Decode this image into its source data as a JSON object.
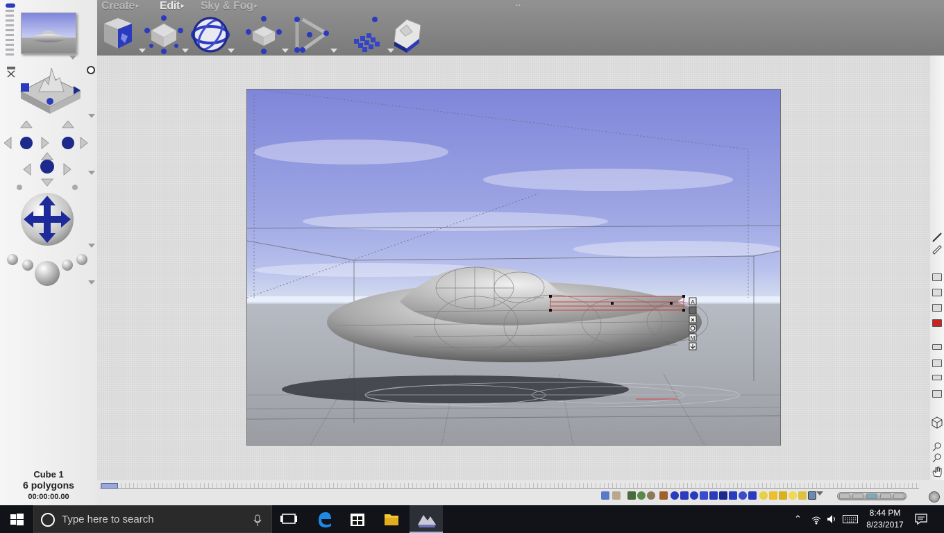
{
  "menu": {
    "create": "Create",
    "edit": "Edit",
    "sky_fog": "Sky & Fog",
    "arrow": "▸",
    "drag_glyph": "↔"
  },
  "toolbar": {
    "tools": [
      "cube-tool-icon",
      "move-nodes-icon",
      "orbit-sphere-icon",
      "scale-nodes-icon",
      "animation-path-icon",
      "grid-array-icon",
      "crystal-rock-icon"
    ]
  },
  "status": {
    "object_name": "Cube 1",
    "polygons": "6 polygons",
    "timecode": "00:00:00.00"
  },
  "gizmo_labels": [
    "A",
    "M"
  ],
  "taskbar": {
    "search_placeholder": "Type here to search",
    "time": "8:44 PM",
    "date": "8/23/2017"
  },
  "colors": {
    "sky_top": "#7f86da",
    "sky_horizon": "#d8e1ef",
    "ground": "#9a9ca2",
    "accent_blue": "#2b3bbd",
    "selection_red": "#d04040"
  }
}
